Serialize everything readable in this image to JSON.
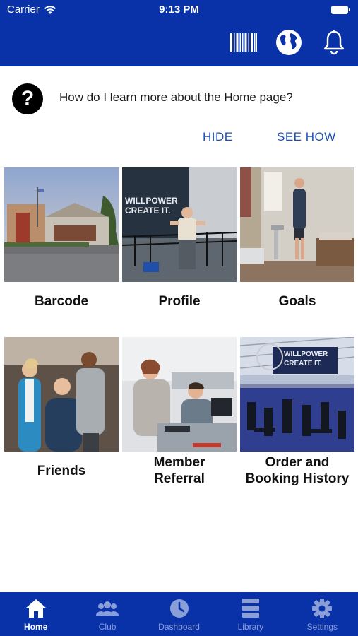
{
  "status": {
    "carrier": "Carrier",
    "time": "9:13 PM"
  },
  "header": {
    "icons": [
      "barcode-icon",
      "globe-icon",
      "bell-icon"
    ],
    "color": "#0a32a8"
  },
  "help": {
    "question": "How do I learn more about the Home page?",
    "hide_label": "HIDE",
    "see_how_label": "SEE HOW"
  },
  "tiles": [
    {
      "label": "Barcode"
    },
    {
      "label": "Profile"
    },
    {
      "label": "Goals"
    },
    {
      "label": "Friends"
    },
    {
      "label_line1": "Member",
      "label_line2": "Referral"
    },
    {
      "label_line1": "Order and",
      "label_line2": "Booking History"
    }
  ],
  "photo_text": {
    "profile_wall": "WILLPOWER\nCREATE IT.",
    "gym_banner": "WILLPOWER\nCREATE IT."
  },
  "tabbar": {
    "active_tab": "Home",
    "tabs": [
      "Home",
      "Club",
      "Dashboard",
      "Library",
      "Settings"
    ]
  }
}
